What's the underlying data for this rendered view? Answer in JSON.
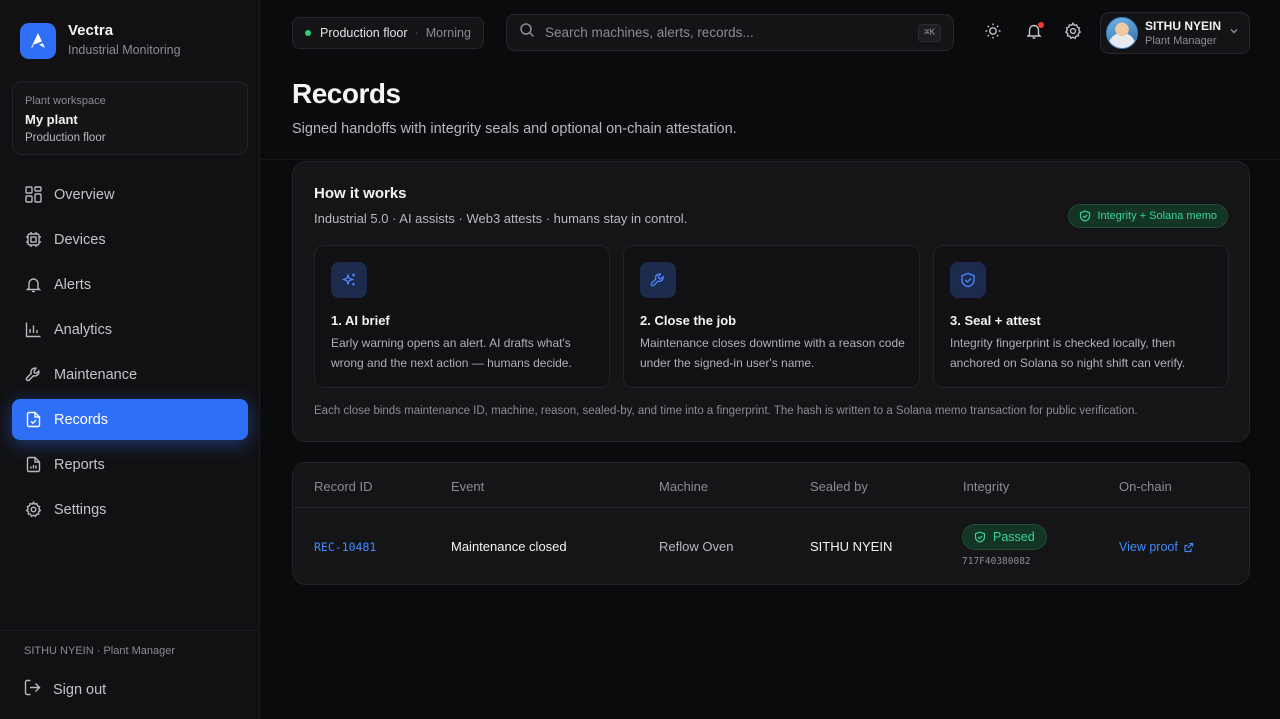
{
  "brand": {
    "name": "Vectra",
    "subtitle": "Industrial Monitoring"
  },
  "workspace": {
    "label": "Plant workspace",
    "name": "My plant",
    "floor": "Production floor"
  },
  "nav": [
    {
      "label": "Overview",
      "icon": "grid-icon"
    },
    {
      "label": "Devices",
      "icon": "chip-icon"
    },
    {
      "label": "Alerts",
      "icon": "bell-icon"
    },
    {
      "label": "Analytics",
      "icon": "bar-chart-icon"
    },
    {
      "label": "Maintenance",
      "icon": "wrench-icon"
    },
    {
      "label": "Records",
      "icon": "file-check-icon",
      "active": true
    },
    {
      "label": "Reports",
      "icon": "report-icon"
    },
    {
      "label": "Settings",
      "icon": "gear-icon"
    }
  ],
  "sidebar_footer": {
    "user": "SITHU NYEIN · Plant Manager",
    "signout": "Sign out"
  },
  "topbar": {
    "floor": "Production floor",
    "separator": "·",
    "shift": "Morning",
    "search_placeholder": "Search machines, alerts, records...",
    "shortcut": "⌘K",
    "user_name": "SITHU NYEIN",
    "user_role": "Plant Manager"
  },
  "header": {
    "title": "Records",
    "subtitle": "Signed handoffs with integrity seals and optional on-chain attestation."
  },
  "how": {
    "title": "How it works",
    "subtitle": "Industrial 5.0 · AI assists · Web3 attests · humans stay in control.",
    "badge": "Integrity + Solana memo",
    "steps": [
      {
        "title": "1. AI brief",
        "desc": "Early warning opens an alert. AI drafts what's wrong and the next action — humans decide.",
        "icon": "sparkles-icon"
      },
      {
        "title": "2. Close the job",
        "desc": "Maintenance closes downtime with a reason code under the signed-in user's name.",
        "icon": "wrench-icon"
      },
      {
        "title": "3. Seal + attest",
        "desc": "Integrity fingerprint is checked locally, then anchored on Solana so night shift can verify.",
        "icon": "shield-icon"
      }
    ],
    "footer": "Each close binds maintenance ID, machine, reason, sealed-by, and time into a fingerprint. The hash is written to a Solana memo transaction for public verification."
  },
  "table": {
    "headers": [
      "Record ID",
      "Event",
      "Machine",
      "Sealed by",
      "Integrity",
      "On-chain"
    ],
    "rows": [
      {
        "id": "REC-10481",
        "event": "Maintenance closed",
        "machine": "Reflow Oven",
        "sealed_by": "SITHU NYEIN",
        "integrity": "Passed",
        "hash": "717F40380082",
        "onchain": "View proof"
      }
    ]
  },
  "colors": {
    "accent": "#2f6ff5",
    "success": "#38d39a",
    "danger": "#ef3b3b",
    "link": "#3d8bff"
  }
}
